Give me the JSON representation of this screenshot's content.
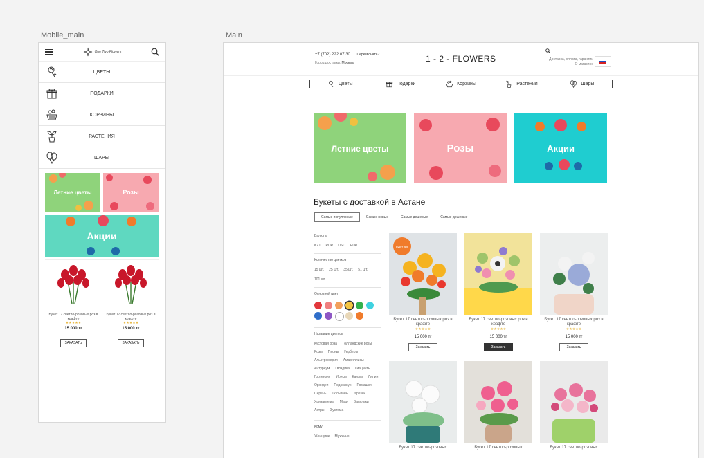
{
  "artboards": {
    "mobile_label": "Mobile_main",
    "desktop_label": "Main"
  },
  "mobile": {
    "logo_text": "One Two Flowers",
    "menu": [
      {
        "label": "ЦВЕТЫ",
        "icon": "rose-icon"
      },
      {
        "label": "ПОДАРКИ",
        "icon": "gift-icon"
      },
      {
        "label": "КОРЗИНЫ",
        "icon": "basket-icon"
      },
      {
        "label": "РАСТЕНИЯ",
        "icon": "plant-icon"
      },
      {
        "label": "ШАРЫ",
        "icon": "balloons-icon"
      }
    ],
    "banners": {
      "summer": "Летние цветы",
      "roses": "Розы",
      "sale": "Акции"
    },
    "products": [
      {
        "name": "Букет 17 светло-розовых роз в крафте",
        "stars": "★★★★★",
        "price": "15 000 тг",
        "button": "ЗАКАЗАТЬ"
      },
      {
        "name": "Букет 17 светло-розовых роз в крафте",
        "stars": "★★★★★",
        "price": "15 000 тг",
        "button": "ЗАКАЗАТЬ"
      }
    ]
  },
  "desktop": {
    "phone": "+7 (702) 222 07 30",
    "callback": "Перезвонить?",
    "city_label": "Город доставки:",
    "city": "Москва",
    "logo": "1 - 2 - FLOWERS",
    "links": [
      "Доставка, оплата, гарантии",
      "О магазине"
    ],
    "nav": [
      {
        "label": "Цветы",
        "icon": "rose-icon"
      },
      {
        "label": "Подарки",
        "icon": "gift-icon"
      },
      {
        "label": "Корзины",
        "icon": "basket-icon"
      },
      {
        "label": "Растения",
        "icon": "plant-icon"
      },
      {
        "label": "Шары",
        "icon": "balloons-icon"
      }
    ],
    "banners": {
      "summer": "Летние цветы",
      "roses": "Розы",
      "sale": "Акции"
    },
    "section_title": "Букеты с доставкой в Астане",
    "sort_options": [
      "Самые популярные",
      "Самые новые",
      "Самые дешевые",
      "Самые дешевые"
    ],
    "filters": {
      "currency_title": "Валюта",
      "currencies": [
        "KZT",
        "RUR",
        "USD",
        "EUR"
      ],
      "count_title": "Количество цветков",
      "counts": [
        "15 шт.",
        "25 шт.",
        "35 шт.",
        "51 шт.",
        "101 шт."
      ],
      "color_title": "Основной цвет",
      "colors": [
        "#e2373c",
        "#f08080",
        "#f2a05c",
        "#f4c542",
        "#34b24e",
        "#3fd2e0",
        "#2f6ec9",
        "#8e57c4",
        "#ffffff",
        "#e8d7b8",
        "#f07b2b"
      ],
      "names_title": "Название цветков",
      "names": [
        "Кустовая роза",
        "Голландские розы",
        "Розы",
        "Пионы",
        "Герберы",
        "Альстромерия",
        "Амариллисы",
        "Антуриум",
        "Гвоздика",
        "Гиацинты",
        "Гортензия",
        "Ирисы",
        "Каллы",
        "Лилии",
        "Орхидеи",
        "Подсолнух",
        "Ромашки",
        "Сирень",
        "Тюльпаны",
        "Фрезии",
        "Хризантемы",
        "Маки",
        "Васильки",
        "Астры",
        "Эустома"
      ],
      "whom_title": "Кому",
      "whom": [
        "Женщине",
        "Мужчине"
      ]
    },
    "badge": "Букет дня",
    "products": [
      {
        "name": "Букет 17 светло-розовых роз в крафте",
        "price": "15 000 тг",
        "button": "Заказать",
        "stars": "★★★★★"
      },
      {
        "name": "Букет 17 светло-розовых роз в крафте",
        "price": "15 000 тг",
        "button": "Заказать",
        "stars": "★★★★★"
      },
      {
        "name": "Букет 17 светло-розовых роз в крафте",
        "price": "15 000 тг",
        "button": "Заказать",
        "stars": "★★★★★"
      },
      {
        "name": "Букет 17 светло-розовых",
        "price": "",
        "button": "",
        "stars": ""
      },
      {
        "name": "Букет 17 светло-розовых",
        "price": "",
        "button": "",
        "stars": ""
      },
      {
        "name": "Букет 17 светло-розовых",
        "price": "",
        "button": "",
        "stars": ""
      }
    ]
  }
}
